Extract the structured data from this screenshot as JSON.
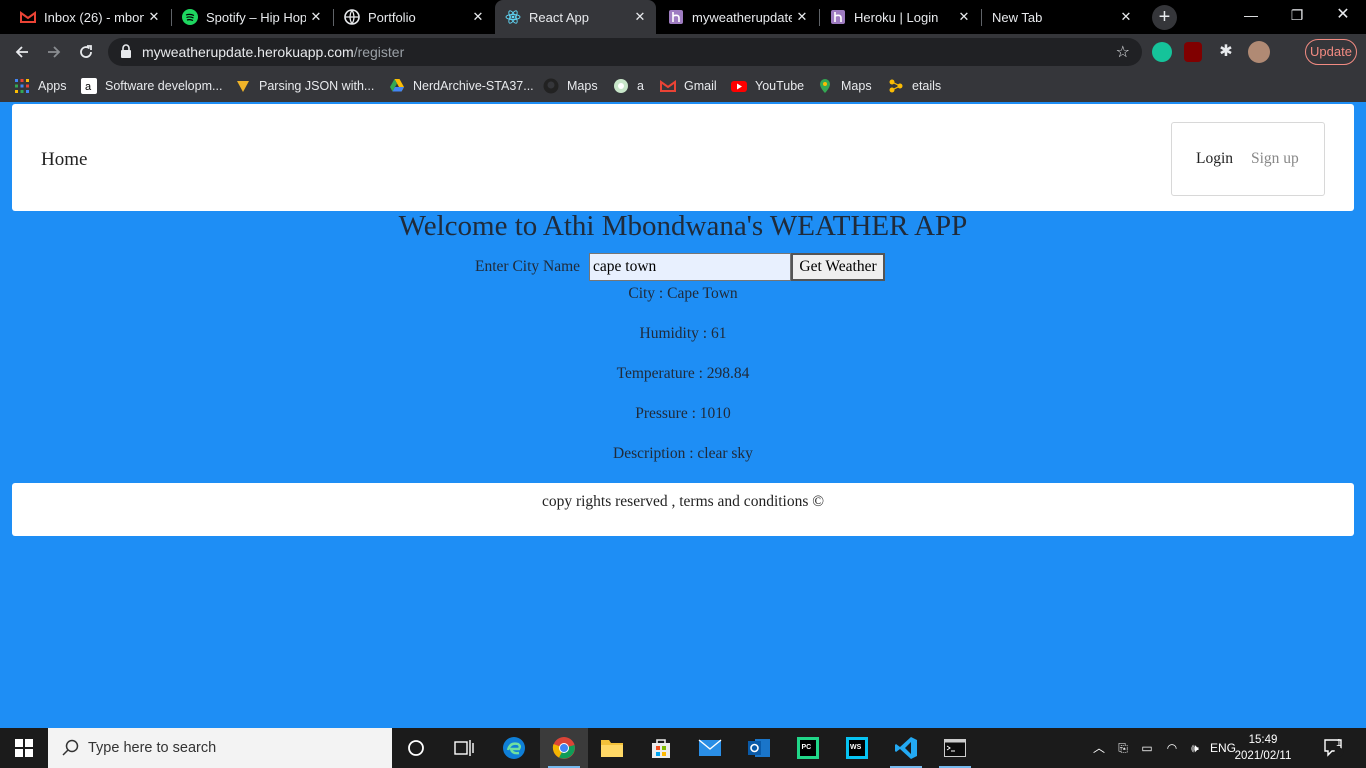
{
  "browser": {
    "tabs": [
      {
        "title": "Inbox (26) - mbon",
        "icon": "gmail-icon"
      },
      {
        "title": "Spotify – Hip Hop",
        "icon": "spotify-icon"
      },
      {
        "title": "Portfolio",
        "icon": "globe-icon"
      },
      {
        "title": "React App",
        "icon": "react-icon"
      },
      {
        "title": "myweatherupdate",
        "icon": "heroku-icon"
      },
      {
        "title": "Heroku | Login",
        "icon": "heroku-icon"
      },
      {
        "title": "New Tab",
        "icon": ""
      }
    ],
    "active_tab": 3,
    "url_host": "myweatherupdate.herokuapp.com",
    "url_path": "/register",
    "update_label": "Update",
    "bookmarks": [
      {
        "label": "Apps"
      },
      {
        "label": "Software developm..."
      },
      {
        "label": "Parsing JSON with..."
      },
      {
        "label": "NerdArchive-STA37..."
      },
      {
        "label": "Maps"
      },
      {
        "label": "a"
      },
      {
        "label": "Gmail"
      },
      {
        "label": "YouTube"
      },
      {
        "label": "Maps"
      },
      {
        "label": "etails"
      }
    ]
  },
  "page": {
    "nav": {
      "home": "Home",
      "login": "Login",
      "signup": "Sign up"
    },
    "title": "Welcome to Athi Mbondwana's WEATHER APP",
    "form": {
      "label": "Enter City Name",
      "city_value": "cape town",
      "button": "Get Weather"
    },
    "results": {
      "city": "City : Cape Town",
      "humidity": "Humidity : 61",
      "temperature": "Temperature : 298.84",
      "pressure": "Pressure : 1010",
      "description": "Description : clear sky"
    },
    "footer": "copy rights reserved , terms and conditions ©"
  },
  "taskbar": {
    "search_placeholder": "Type here to search",
    "language": "ENG",
    "time": "15:49",
    "date": "2021/02/11",
    "notifications": "1"
  },
  "colors": {
    "page_bg": "#1e8ef5",
    "chrome_dark": "#35363a",
    "update_accent": "#f28b82"
  }
}
